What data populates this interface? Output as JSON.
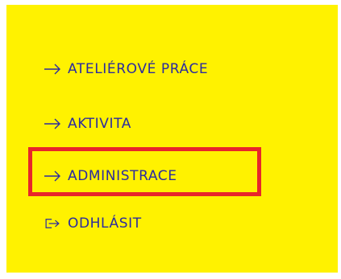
{
  "menu": {
    "items": [
      {
        "label": "ATELIÉROVÉ PRÁCE",
        "icon": "arrow-right-icon"
      },
      {
        "label": "AKTIVITA",
        "icon": "arrow-right-icon"
      },
      {
        "label": "ADMINISTRACE",
        "icon": "arrow-right-icon"
      },
      {
        "label": "ODHLÁSIT",
        "icon": "logout-icon"
      }
    ],
    "highlighted_item": "ADMINISTRACE"
  },
  "colors": {
    "background": "#fff200",
    "text": "#2b2ba0",
    "highlight": "#e8262a"
  }
}
